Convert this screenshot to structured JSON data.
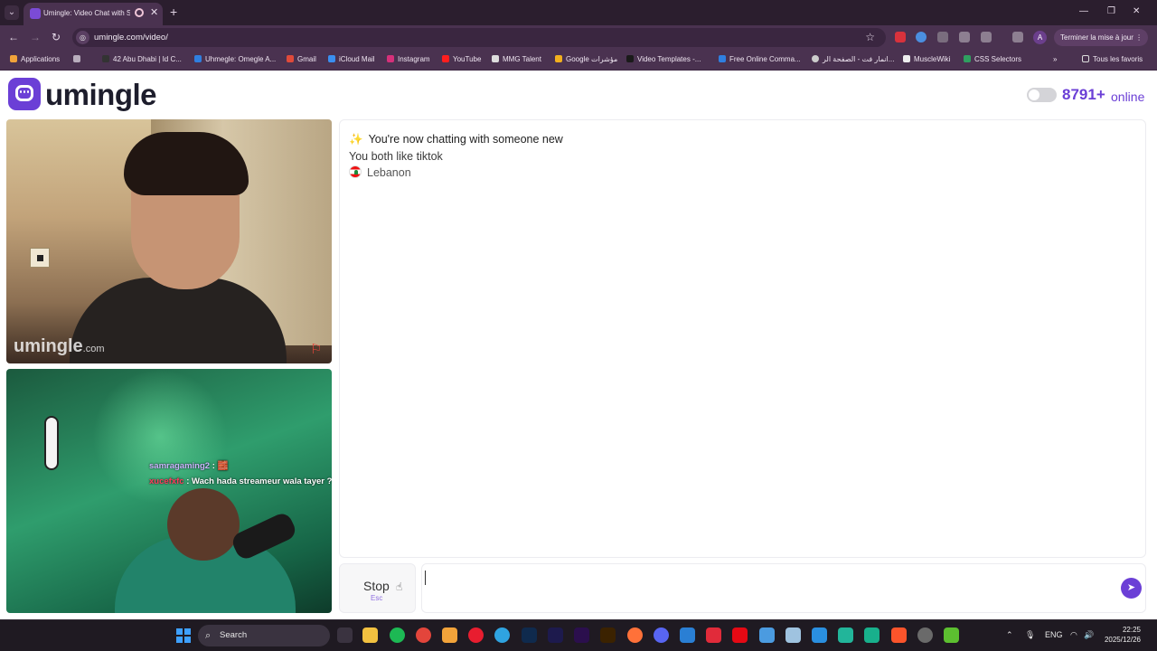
{
  "browser": {
    "tab_title": "Umingle: Video Chat with S",
    "url": "umingle.com/video/",
    "update_label": "Terminer la mise à jour",
    "profile_initial": "A",
    "bookmarks": [
      "Applications",
      "42 Abu Dhabi | Id C...",
      "Uhmegle: Omegle A...",
      "Gmail",
      "iCloud Mail",
      "Instagram",
      "YouTube",
      "MMG Talent",
      "Google مؤشرات",
      "Video Templates -...",
      "Free Online Comma...",
      "انمار فت - الصفحة الر...",
      "MuscleWiki",
      "CSS Selectors"
    ],
    "all_bookmarks": "Tous les favoris"
  },
  "page": {
    "logo_text": "umingle",
    "online_count": "8791+",
    "online_label": "online"
  },
  "stranger_video": {
    "watermark": "umingle",
    "watermark_suffix": ".com"
  },
  "self_video": {
    "overlay_chat": [
      {
        "user": "samragaming2",
        "text": " : 🧱"
      },
      {
        "user": "xucefxfc",
        "text": " : Wach hada streameur wala tayer ? 🦅👏"
      }
    ]
  },
  "chat": {
    "system_message": "You're now chatting with someone new",
    "interest_message": "You both like tiktok",
    "country": "Lebanon"
  },
  "controls": {
    "stop_label": "Stop",
    "stop_shortcut": "Esc",
    "message_placeholder": "",
    "message_value": ""
  },
  "taskbar": {
    "search_label": "Search",
    "language": "ENG",
    "time": "22:25",
    "date": "2025/12/26"
  },
  "colors": {
    "brand": "#6b3fd6",
    "browser_frame": "#4a3250",
    "report_flag": "#e8443a"
  }
}
